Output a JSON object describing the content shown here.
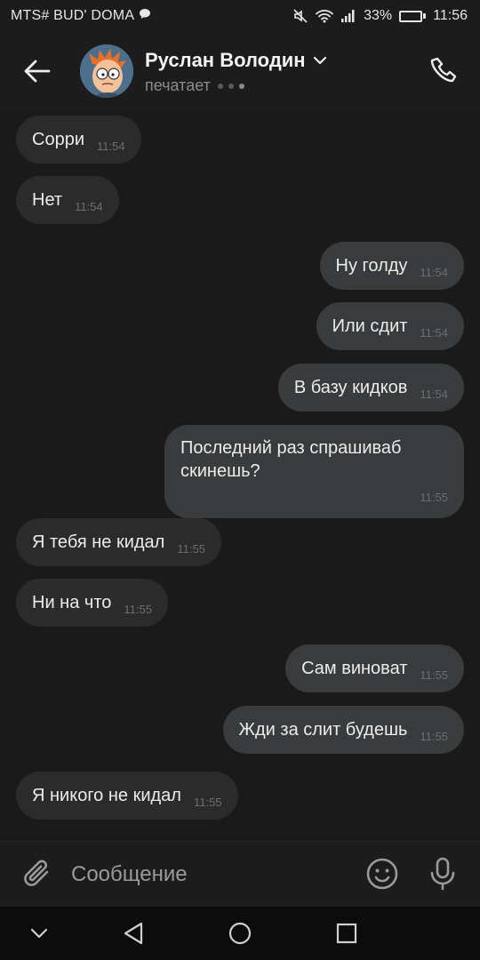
{
  "status_bar": {
    "carrier": "MTS# BUD' DOMA",
    "battery_percent": "33%",
    "battery_level": 0.33,
    "time": "11:56",
    "icons": [
      "chat-notification-icon",
      "mute-icon",
      "wifi-icon",
      "signal-icon",
      "battery-icon"
    ]
  },
  "header": {
    "contact_name": "Руслан Володин",
    "status": "печатает",
    "icons": [
      "back-arrow-icon",
      "chevron-down-icon",
      "phone-icon"
    ]
  },
  "messages": [
    {
      "direction": "incoming",
      "text": "Сорри",
      "time": "11:54"
    },
    {
      "direction": "incoming",
      "text": "Нет",
      "time": "11:54"
    },
    {
      "direction": "outgoing",
      "text": "Ну голду",
      "time": "11:54"
    },
    {
      "direction": "outgoing",
      "text": "Или сдит",
      "time": "11:54"
    },
    {
      "direction": "outgoing",
      "text": "В базу кидков",
      "time": "11:54"
    },
    {
      "direction": "outgoing",
      "text": "Последний раз спрашиваб скинешь?",
      "time": "11:55"
    },
    {
      "direction": "incoming",
      "text": "Я тебя не кидал",
      "time": "11:55"
    },
    {
      "direction": "incoming",
      "text": "Ни на что",
      "time": "11:55"
    },
    {
      "direction": "outgoing",
      "text": "Сам виноват",
      "time": "11:55"
    },
    {
      "direction": "outgoing",
      "text": "Жди за слит будешь",
      "time": "11:55"
    },
    {
      "direction": "incoming",
      "text": "Я никого не кидал",
      "time": "11:55"
    }
  ],
  "composer": {
    "placeholder": "Сообщение",
    "value": "",
    "icons": [
      "paperclip-icon",
      "emoji-icon",
      "microphone-icon"
    ]
  },
  "nav_bar": {
    "icons": [
      "nav-down-chevron-icon",
      "nav-back-icon",
      "nav-home-icon",
      "nav-recents-icon"
    ]
  },
  "colors": {
    "background": "#1a1a1a",
    "incoming_bubble": "#2b2b2c",
    "outgoing_bubble": "#3a3b3c",
    "text": "#ececec",
    "secondary_text": "#8c8c8c"
  }
}
